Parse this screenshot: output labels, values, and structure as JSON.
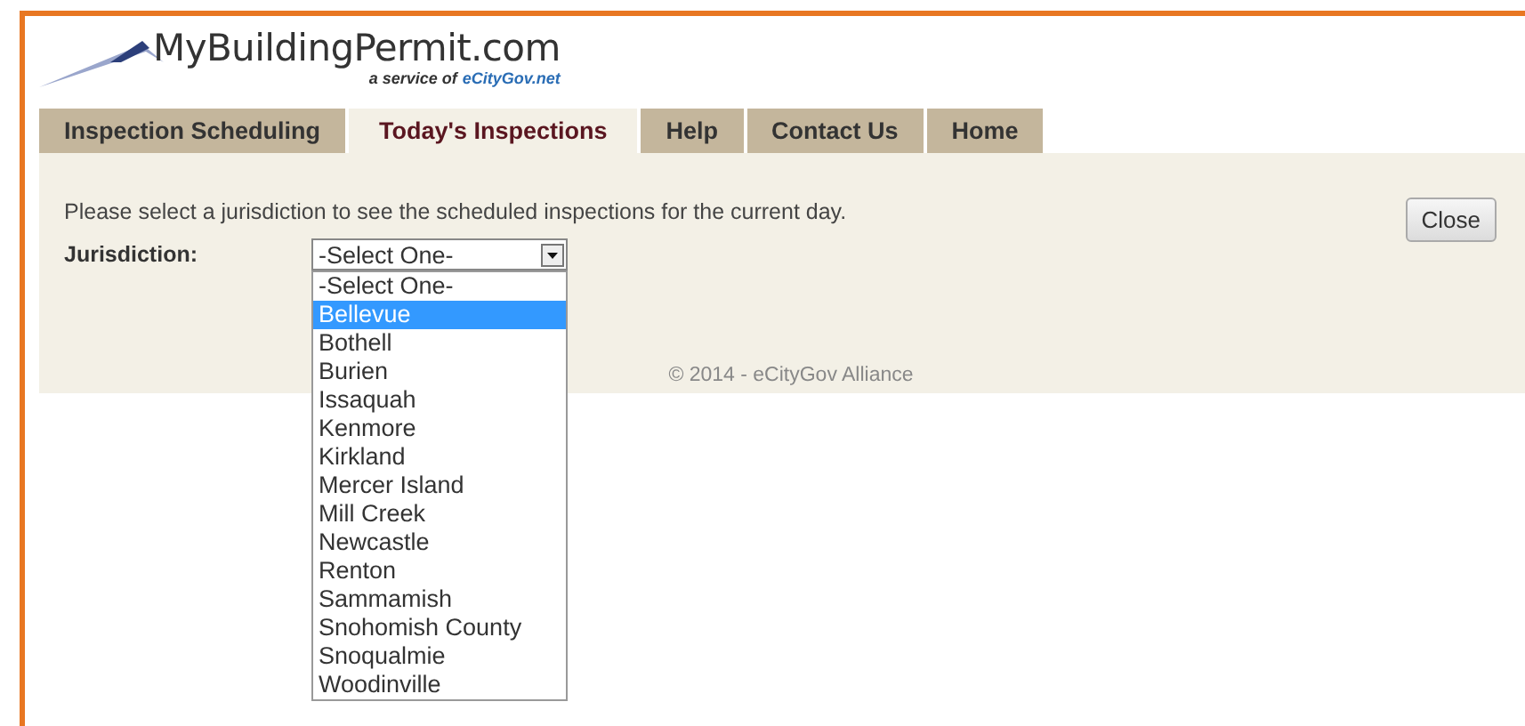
{
  "logo": {
    "title": "MyBuildingPermit.com",
    "tagline": "a service of",
    "tagline_link": "eCityGov.net"
  },
  "tabs": [
    {
      "label": "Inspection Scheduling",
      "selected": false
    },
    {
      "label": "Today's Inspections",
      "selected": true
    },
    {
      "label": "Help",
      "selected": false
    },
    {
      "label": "Contact Us",
      "selected": false
    },
    {
      "label": "Home",
      "selected": false
    }
  ],
  "instructions": "Please select a jurisdiction to see the scheduled inspections for the current day.",
  "close_button": "Close",
  "jurisdiction": {
    "label": "Jurisdiction:",
    "value": "-Select One-",
    "expanded": true,
    "options": [
      {
        "label": "-Select One-",
        "highlighted": false
      },
      {
        "label": "Bellevue",
        "highlighted": true
      },
      {
        "label": "Bothell",
        "highlighted": false
      },
      {
        "label": "Burien",
        "highlighted": false
      },
      {
        "label": "Issaquah",
        "highlighted": false
      },
      {
        "label": "Kenmore",
        "highlighted": false
      },
      {
        "label": "Kirkland",
        "highlighted": false
      },
      {
        "label": "Mercer Island",
        "highlighted": false
      },
      {
        "label": "Mill Creek",
        "highlighted": false
      },
      {
        "label": "Newcastle",
        "highlighted": false
      },
      {
        "label": "Renton",
        "highlighted": false
      },
      {
        "label": "Sammamish",
        "highlighted": false
      },
      {
        "label": "Snohomish County",
        "highlighted": false
      },
      {
        "label": "Snoqualmie",
        "highlighted": false
      },
      {
        "label": "Woodinville",
        "highlighted": false
      }
    ]
  },
  "footer": "© 2014 - eCityGov Alliance"
}
